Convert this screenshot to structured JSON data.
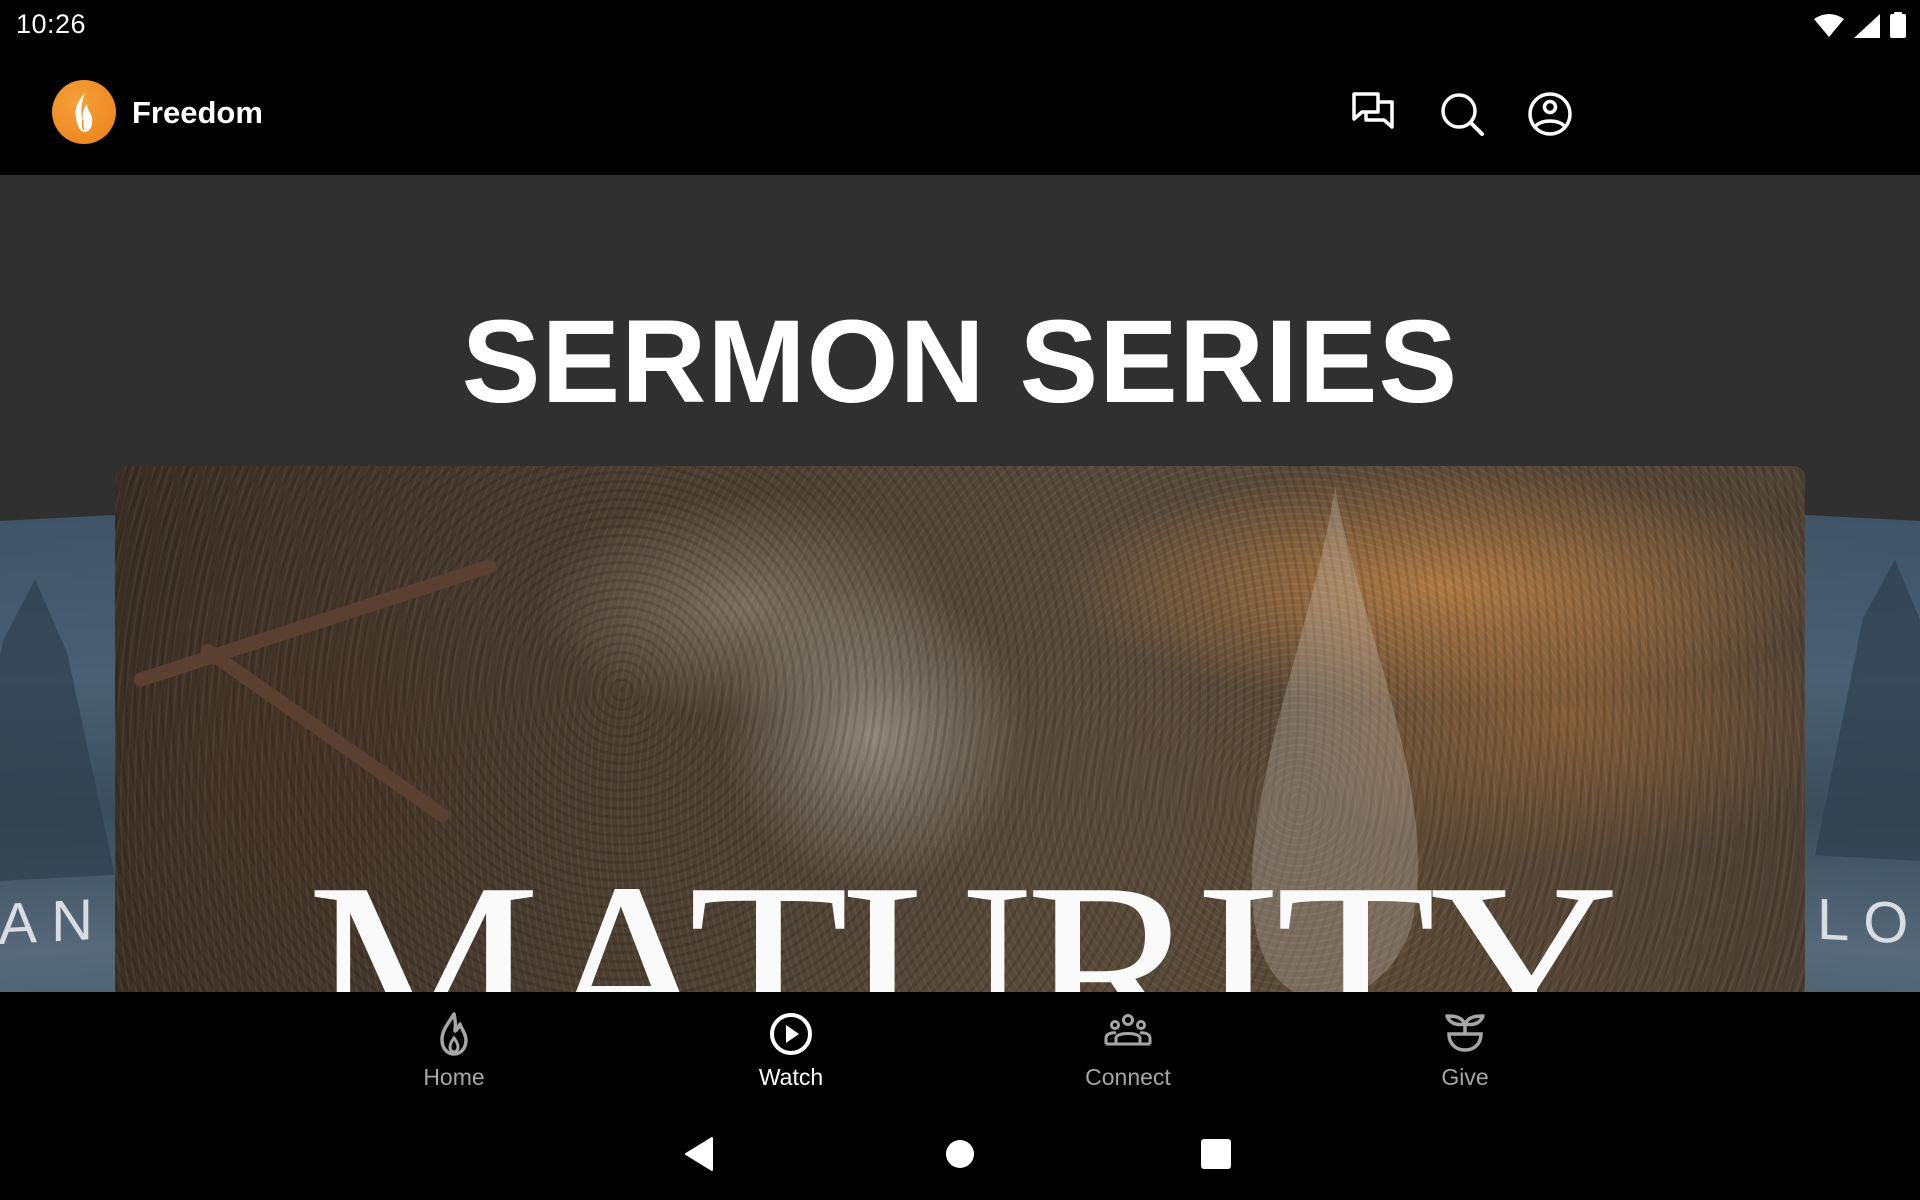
{
  "status_bar": {
    "time": "10:26",
    "icons": [
      "wifi-icon",
      "cellular-signal-icon",
      "battery-icon"
    ]
  },
  "app_bar": {
    "title": "Freedom",
    "logo_icon": "flame-logo-icon",
    "actions": [
      {
        "name": "messages",
        "icon": "chat-bubbles-icon"
      },
      {
        "name": "search",
        "icon": "search-icon"
      },
      {
        "name": "account",
        "icon": "account-circle-icon"
      }
    ]
  },
  "main": {
    "section_title": "SERMON SERIES",
    "carousel": {
      "previous_card_text": "AN",
      "current_card_title": "MATURITY",
      "next_card_text": "LO"
    }
  },
  "bottom_nav": {
    "items": [
      {
        "label": "Home",
        "icon": "flame-icon",
        "active": false
      },
      {
        "label": "Watch",
        "icon": "play-circle-icon",
        "active": true
      },
      {
        "label": "Connect",
        "icon": "group-icon",
        "active": false
      },
      {
        "label": "Give",
        "icon": "plant-bowl-icon",
        "active": false
      }
    ]
  },
  "system_nav": {
    "buttons": [
      "back",
      "home",
      "recents"
    ]
  },
  "colors": {
    "accent": "#EE8A22",
    "background": "#000000",
    "content_background": "#303030",
    "nav_inactive": "#A6A6A6",
    "nav_active": "#FFFFFF"
  }
}
